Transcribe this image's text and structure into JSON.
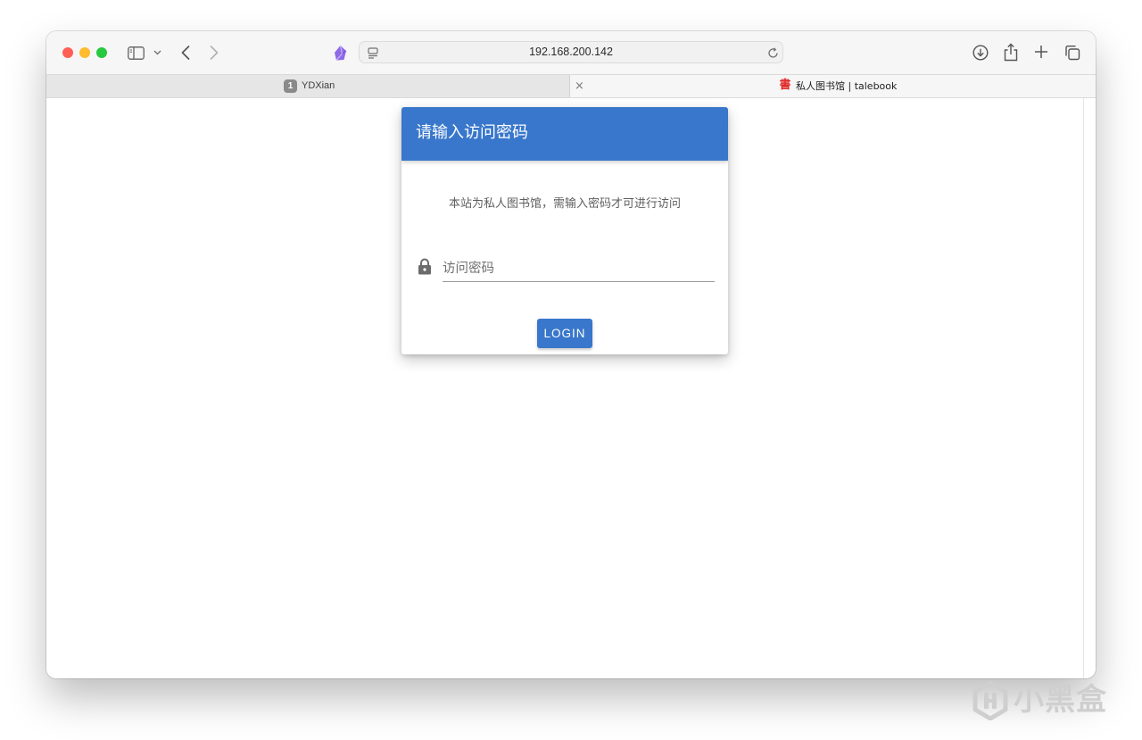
{
  "browser": {
    "address_bar": {
      "url": "192.168.200.142"
    },
    "tabs": [
      {
        "badge": "1",
        "title": "YDXian",
        "active": false
      },
      {
        "favicon": "書",
        "title": "私人图书馆 | talebook",
        "active": true
      }
    ],
    "tab_close_glyph": "×",
    "toolbar_icons": [
      "sidebar-icon",
      "chevron-down-icon",
      "back-icon",
      "forward-icon",
      "extension-icon",
      "page-settings-icon",
      "reload-icon",
      "download-icon",
      "share-icon",
      "new-tab-icon",
      "tab-overview-icon"
    ]
  },
  "login_dialog": {
    "title": "请输入访问密码",
    "message": "本站为私人图书馆，需输入密码才可进行访问",
    "password_placeholder": "访问密码",
    "password_value": "",
    "login_label": "LOGIN"
  },
  "watermark": {
    "text": "小黑盒"
  },
  "colors": {
    "primary": "#3877cb",
    "traffic_red": "#ff5f57",
    "traffic_yellow": "#febc2e",
    "traffic_green": "#28c840",
    "favicon_red": "#e02a2a"
  }
}
